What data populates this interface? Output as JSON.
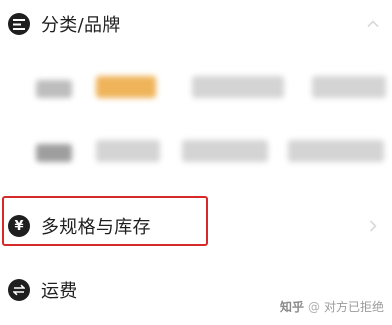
{
  "sections": {
    "category": {
      "label": "分类/品牌",
      "icon": "list-filter-icon"
    },
    "spec": {
      "label": "多规格与库存",
      "icon": "yen-icon",
      "icon_glyph": "¥"
    },
    "shipping": {
      "label": "运费",
      "icon": "shipping-exchange-icon"
    }
  },
  "watermark": {
    "brand": "知乎",
    "separator": "@",
    "author": "对方已拒绝"
  },
  "colors": {
    "text": "#1f1f1f",
    "highlight": "#d62a2a",
    "selected_option": "#efb45a"
  }
}
